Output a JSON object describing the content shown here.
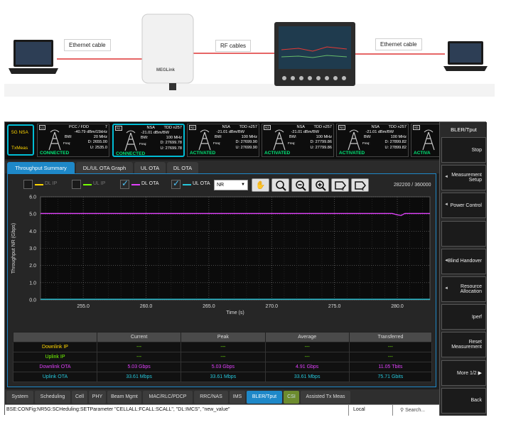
{
  "diagram": {
    "edges": [
      {
        "label": "Ethernet cable"
      },
      {
        "label": "RF cables"
      },
      {
        "label": "Ethernet cable"
      }
    ],
    "device_brand": "MEGLink"
  },
  "mode": {
    "line1": "5G NSA",
    "line2": "TxMeas"
  },
  "cells": [
    {
      "tag": "L1",
      "title": "PCC / FDD",
      "num": "7",
      "power": "-40.79 dBm/15kHz",
      "bw_label": "BW:",
      "bw": "20 MHz",
      "freq_label": "Freq:",
      "d": "D: 2655.00",
      "u": "U: 2535.0",
      "status": "CONNECTED"
    },
    {
      "tag": "N1",
      "title": "NSA",
      "band": "TDD n257",
      "power": "-21.01 dBm/BW",
      "bw_label": "BW:",
      "bw": "100 MHz",
      "freq_label": "Freq:",
      "d": "D: 27699.78",
      "u": "U: 27699.78",
      "status": "CONNECTED"
    },
    {
      "tag": "N2",
      "title": "NSA",
      "band": "TDD n257",
      "power": "-21.01 dBm/BW",
      "bw_label": "BW:",
      "bw": "100 MHz",
      "freq_label": "Freq:",
      "d": "D: 27699.90",
      "u": "U: 27699.90",
      "status": "ACTIVATED"
    },
    {
      "tag": "N3",
      "title": "NSA",
      "band": "TDD n257",
      "power": "-21.01 dBm/BW",
      "bw_label": "BW:",
      "bw": "100 MHz",
      "freq_label": "Freq:",
      "d": "D: 27799.86",
      "u": "U: 27799.86",
      "status": "ACTIVATED"
    },
    {
      "tag": "N4",
      "title": "NSA",
      "band": "TDD n257",
      "power": "-21.01 dBm/BW",
      "bw_label": "BW:",
      "bw": "100 MHz",
      "freq_label": "Freq:",
      "d": "D: 27899.82",
      "u": "U: 27899.82",
      "status": "ACTIVATED"
    },
    {
      "tag": "N5",
      "status": "ACTIVA"
    }
  ],
  "tabs": [
    {
      "label": "Throughput Summary",
      "active": true
    },
    {
      "label": "DL/UL OTA Graph"
    },
    {
      "label": "UL OTA"
    },
    {
      "label": "DL OTA"
    }
  ],
  "legend": [
    {
      "label": "DL IP",
      "checked": false,
      "color": "#ffd600"
    },
    {
      "label": "UL IP",
      "checked": false,
      "color": "#76ff03"
    },
    {
      "label": "DL OTA",
      "checked": true,
      "color": "#e040fb"
    },
    {
      "label": "UL OTA",
      "checked": true,
      "color": "#26c6da"
    }
  ],
  "rat_select": "NR",
  "sample_count": "282200 / 360000",
  "chart_data": {
    "type": "line",
    "xlabel": "Time (s)",
    "ylabel": "Throughput NR (Gbps)",
    "xlim": [
      251.6,
      282.6
    ],
    "ylim": [
      0,
      6
    ],
    "xticks": [
      "255.0",
      "260.0",
      "265.0",
      "270.0",
      "275.0",
      "280.0"
    ],
    "yticks": [
      "0.0",
      "1.0",
      "2.0",
      "3.0",
      "4.0",
      "5.0",
      "6.0"
    ],
    "grid": true,
    "series": [
      {
        "name": "DL OTA",
        "color": "#e040fb",
        "x": [
          251.6,
          279.6,
          280.0,
          280.3,
          280.6,
          282.6
        ],
        "y": [
          5.03,
          5.03,
          4.95,
          4.91,
          5.03,
          5.03
        ]
      },
      {
        "name": "UL OTA",
        "color": "#26c6da",
        "x": [
          251.6,
          282.6
        ],
        "y": [
          0.034,
          0.034
        ]
      }
    ]
  },
  "table": {
    "headers": [
      "",
      "Current",
      "Peak",
      "Average",
      "Transferred"
    ],
    "rows": [
      {
        "label": "Downlink IP",
        "color": "#ffd600",
        "cells": [
          "---",
          "---",
          "---",
          "---"
        ],
        "cell_color": "#76ff03"
      },
      {
        "label": "Uplink IP",
        "color": "#76ff03",
        "cells": [
          "---",
          "---",
          "---",
          "---"
        ],
        "cell_color": "#76ff03"
      },
      {
        "label": "Downlink OTA",
        "color": "#e040fb",
        "cells": [
          "5.03 Gbps",
          "5.03 Gbps",
          "4.91 Gbps",
          "11.05 Tbits"
        ],
        "cell_color": "#e040fb"
      },
      {
        "label": "Uplink OTA",
        "color": "#26c6da",
        "cells": [
          "33.61 Mbps",
          "33.61 Mbps",
          "33.61 Mbps",
          "75.71 Gbits"
        ],
        "cell_color": "#26c6da"
      }
    ]
  },
  "menu": [
    {
      "label": "System"
    },
    {
      "label": "Scheduling"
    },
    {
      "label": "Cell"
    },
    {
      "label": "PHY"
    },
    {
      "label": "Beam Mgmt"
    },
    {
      "label": "MAC/RLC/PDCP"
    },
    {
      "label": "RRC/NAS"
    },
    {
      "label": "IMS"
    },
    {
      "label": "BLER/Tput",
      "active": true
    },
    {
      "label": "CSI",
      "csi": true
    },
    {
      "label": "Assisted Tx Meas"
    }
  ],
  "command": {
    "text": "BSE:CONFig:NR5G:SCHeduling:SETParameter \"CELLALL:FCALL:SCALL\", \"DL:IMCS\", \"new_value\"",
    "location": "Local",
    "search": "Search..."
  },
  "softkeys": {
    "title": "BLER/Tput",
    "keys": [
      {
        "label": "Stop",
        "arrow": false
      },
      {
        "label": "Measurement Setup",
        "arrow": true
      },
      {
        "label": "Power Control",
        "arrow": true
      },
      {
        "label": "",
        "arrow": false
      },
      {
        "label": "Blind Handover",
        "arrow": true
      },
      {
        "label": "Resource Allocation",
        "arrow": true
      },
      {
        "label": "Iperf",
        "arrow": false
      },
      {
        "label": "Reset Measurement",
        "arrow": false
      },
      {
        "label": "More 1/2 ▶",
        "arrow": false
      },
      {
        "label": "Back",
        "arrow": false
      }
    ]
  }
}
